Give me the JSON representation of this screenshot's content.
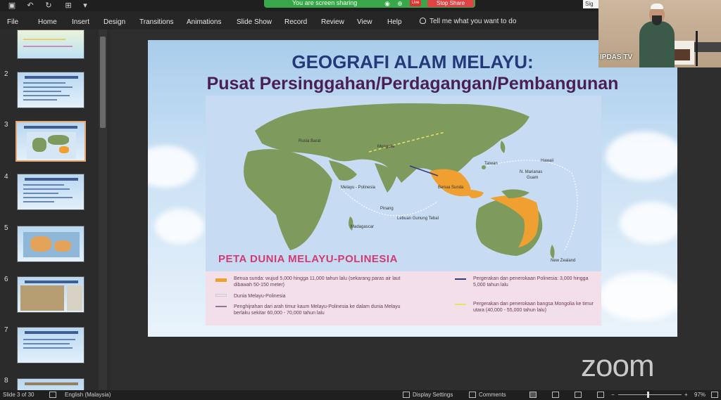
{
  "titlebar": {
    "sharing_text": "You are screen sharing",
    "live_label": "Live",
    "stop_share": "Stop Share",
    "sign_in": "Sig"
  },
  "menu": {
    "items": [
      "File",
      "Home",
      "Insert",
      "Design",
      "Transitions",
      "Animations",
      "Slide Show",
      "Record",
      "Review",
      "View",
      "Help"
    ],
    "tell_me": "Tell me what you want to do"
  },
  "thumbnails": {
    "numbers": [
      "2",
      "3",
      "4",
      "5",
      "6",
      "7",
      "8"
    ],
    "selected": "3"
  },
  "slide": {
    "title": "GEOGRAFI ALAM MELAYU:",
    "subtitle": "Pusat Persinggahan/Perdagangan/Pembangunan",
    "map_title": "PETA DUNIA MELAYU-POLINESIA",
    "legend": [
      "Benua sunda: wujud 5,000 hingga 11,000 tahun lalu (sekarang paras air laut dibawah 50-150 meter)",
      "Dunia Melayu-Polinesia",
      "Penghijrahan dari arah timur kaum Melayu-Polinesia ke dalam dunia Melayu berlaku sekitar 60,000 - 70,000 tahun lalu",
      "Pergerakan dan penerokaan Polinesia: 3,000 hingga 5,000 tahun lalu",
      "Pergerakan dan penerokaan bangsa Mongolia ke timur utara (40,000 - 55,000 tahun lalu)"
    ],
    "map_labels": {
      "rusia": "Rusia Barat",
      "mongolia": "Mongolia",
      "taiwan": "Taiwan",
      "hawaii": "Hawaii",
      "mariana": "N. Marianas",
      "guam": "Guam",
      "melayu": "Melayu - Polinesia",
      "pinang": "Pinang",
      "madagascar": "Madagascar",
      "sunda": "Benua Sunda",
      "gunung": "Lebuan Gunung Tebal",
      "nz": "New Zealand"
    }
  },
  "webcam": {
    "label": "IPDAS TV"
  },
  "watermark": "zoom",
  "status": {
    "slide_of": "Slide 3 of 30",
    "language": "English (Malaysia)",
    "display_settings": "Display Settings",
    "comments": "Comments",
    "zoom_level": "97%"
  },
  "colors": {
    "title_blue": "#23397a",
    "subtitle_purple": "#4a1f55",
    "map_title_pink": "#d23a73",
    "land_green": "#7e9a5d",
    "sunda_orange": "#f0a030",
    "share_green": "#3aa64a",
    "stop_red": "#e04343"
  }
}
